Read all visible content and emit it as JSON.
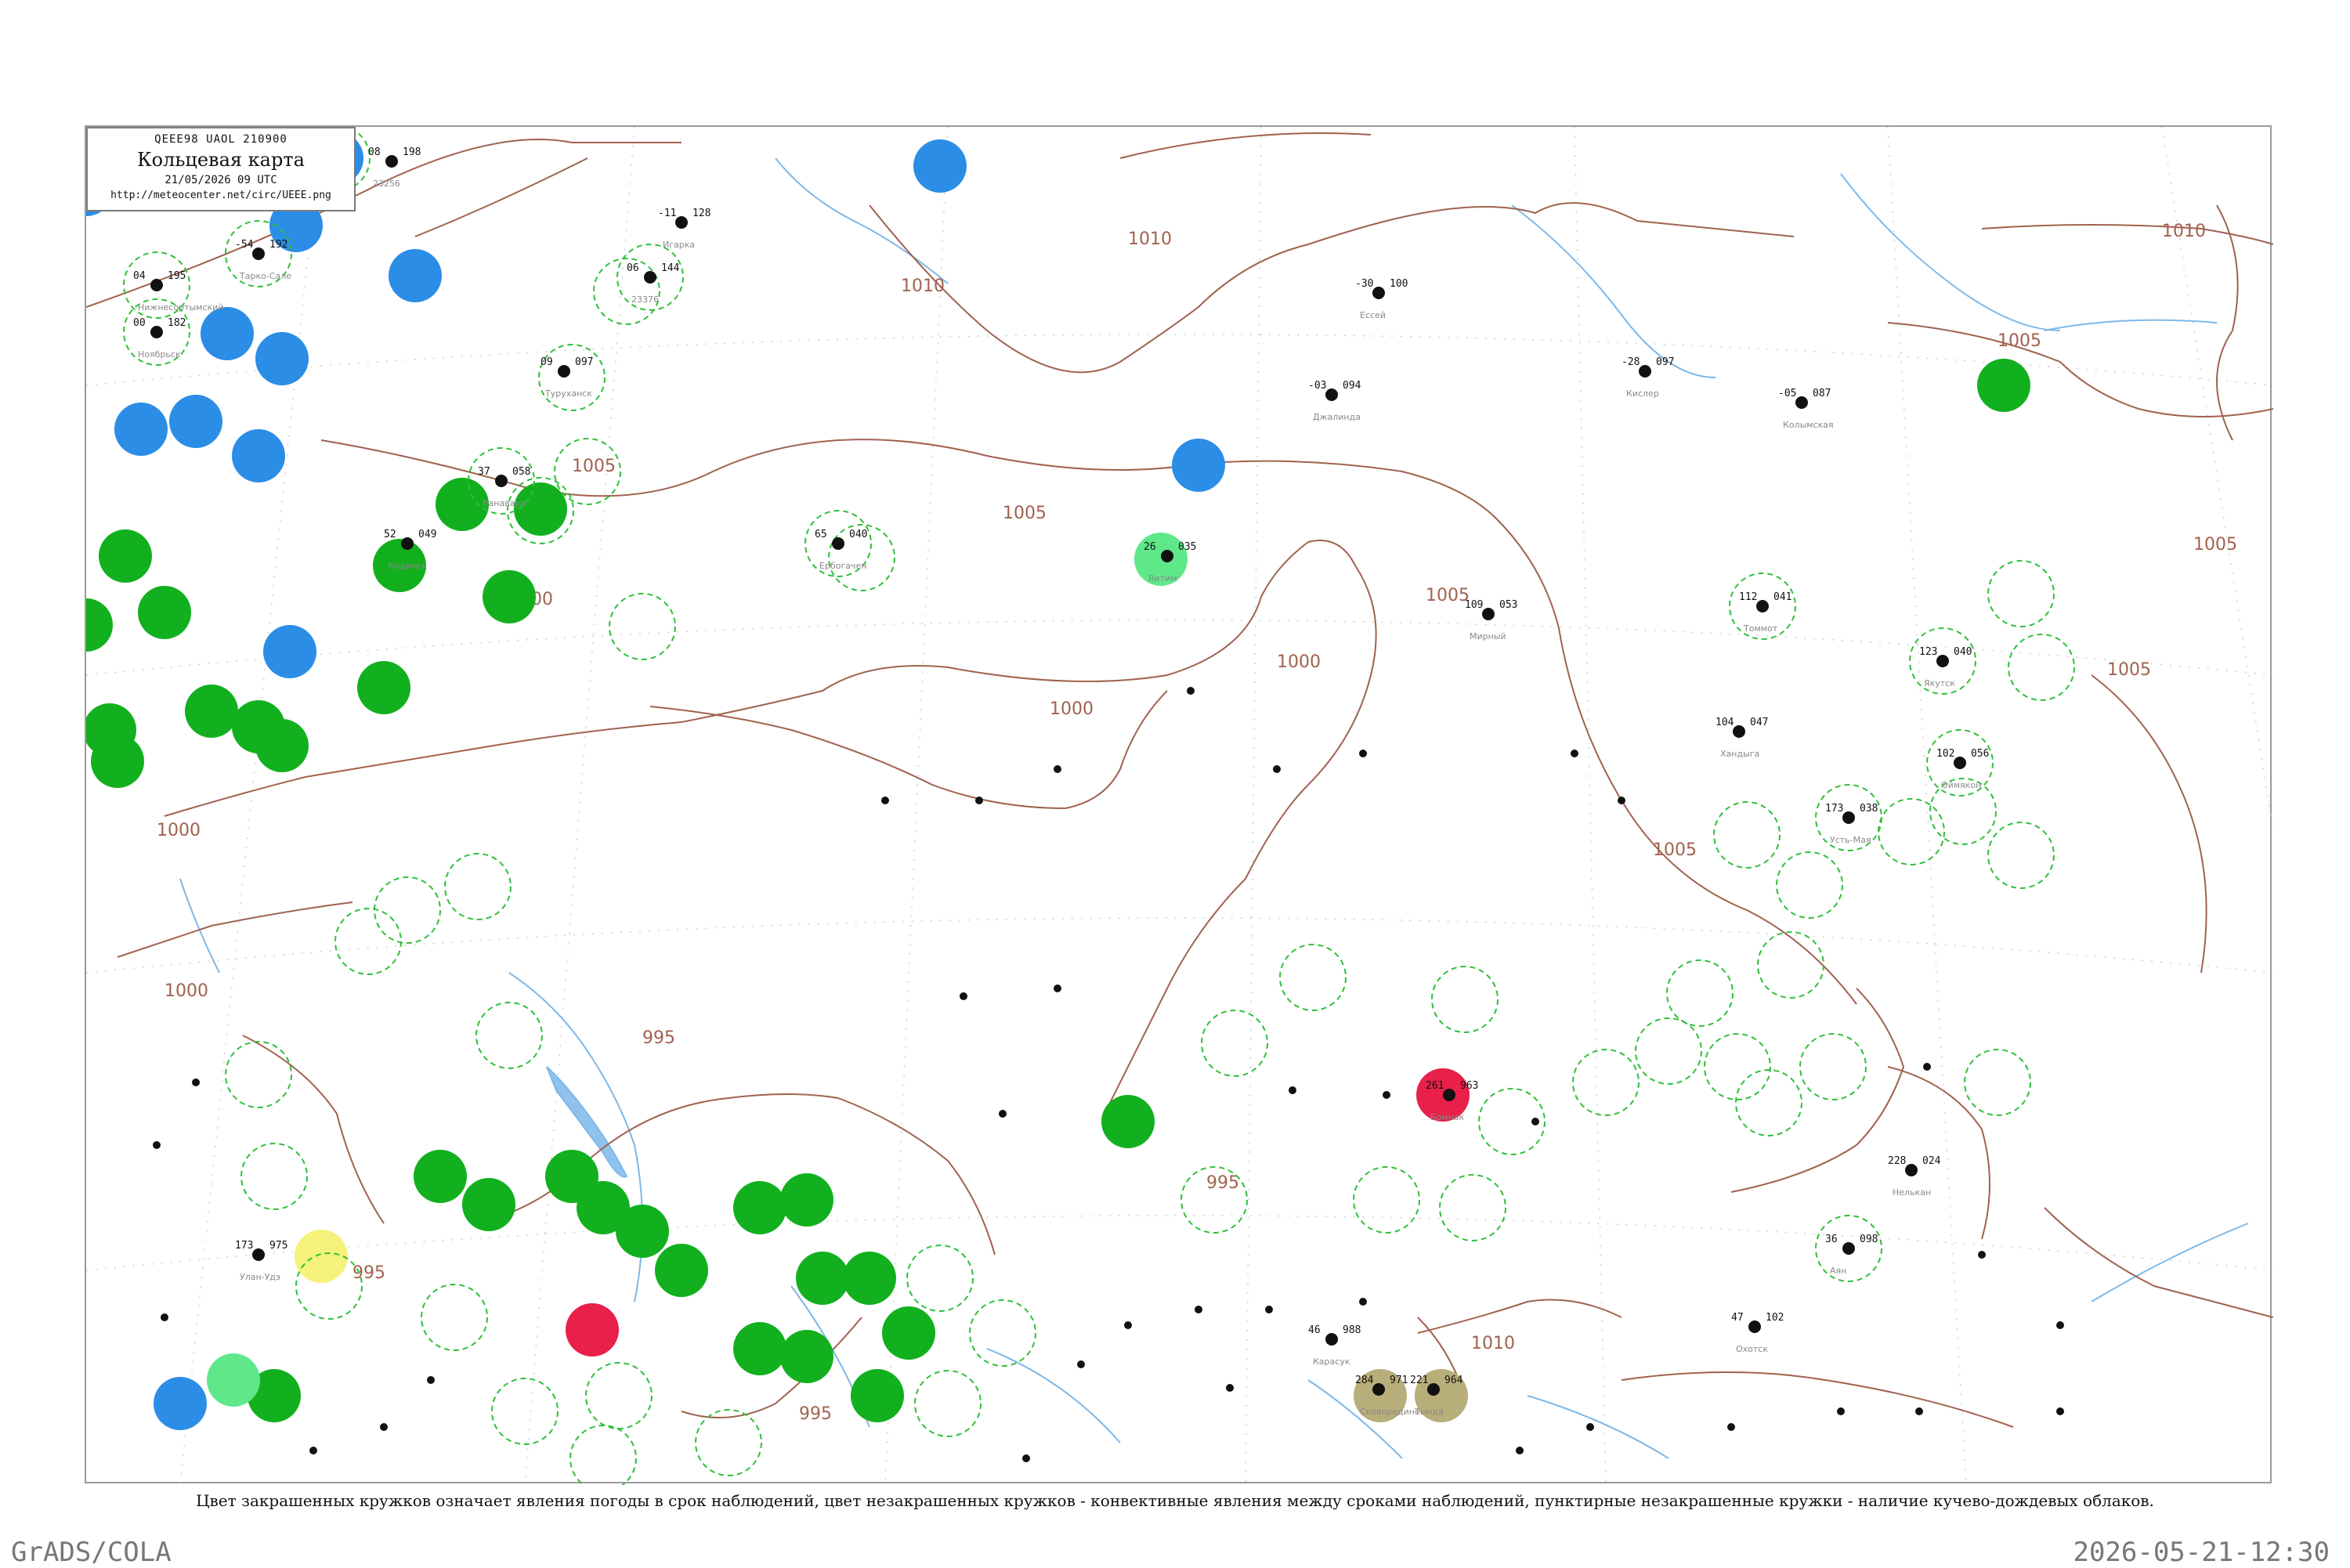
{
  "header": {
    "code": "QEEE98  UAOL  210900",
    "title": "Кольцевая карта",
    "date": "21/05/2026 09 UTC",
    "url": "http://meteocenter.net/circ/UEEE.png"
  },
  "caption": "Цвет закрашенных кружков означает явления погоды в срок наблюдений, цвет незакрашенных кружков - конвективные явления между сроками наблюдений, пунктирные незакрашенные кружки - наличие кучево-дождевых облаков.",
  "footer": {
    "left": "GrADS/COLA",
    "right": "2026-05-21-12:30"
  },
  "colors": {
    "isobar": "#a0624f",
    "river": "#7db8e8",
    "cb_ring": "#2fbf3a",
    "rain": "#12b01e",
    "snow": "#2b8de6",
    "thunder": "#e8204a",
    "fog": "#f4f27a",
    "dust": "#b8ae7a",
    "drizzle": "#5ee88a"
  },
  "isobars": [
    {
      "label": "1010"
    },
    {
      "label": "1010"
    },
    {
      "label": "1010"
    },
    {
      "label": "1005"
    },
    {
      "label": "1005"
    },
    {
      "label": "1005"
    },
    {
      "label": "1005"
    },
    {
      "label": "1000"
    },
    {
      "label": "1000"
    },
    {
      "label": "1000"
    },
    {
      "label": "1000"
    },
    {
      "label": "995"
    },
    {
      "label": "995"
    },
    {
      "label": "995"
    },
    {
      "label": "1010"
    },
    {
      "label": "1005"
    },
    {
      "label": "1005"
    },
    {
      "label": "1005"
    },
    {
      "label": "1000"
    },
    {
      "label": "995"
    }
  ],
  "stations": [
    {
      "p": "198",
      "t": "08",
      "name": "23256",
      "wx": "snow"
    },
    {
      "p": "195",
      "t": "04",
      "name": "Нижнесортымский",
      "wx": "cb"
    },
    {
      "p": "192",
      "t": "-54",
      "name": "Тарко-Сале",
      "wx": "cb"
    },
    {
      "p": "182",
      "t": "00",
      "name": "Ноябрьск",
      "wx": "cb"
    },
    {
      "p": "128",
      "t": "-11",
      "name": "Игарка",
      "wx": "none"
    },
    {
      "p": "144",
      "t": "06",
      "name": "23376",
      "wx": "cb"
    },
    {
      "p": "097",
      "t": "09",
      "name": "Туруханск",
      "wx": "none"
    },
    {
      "p": "100",
      "t": "-30",
      "name": "Ессей",
      "wx": "none"
    },
    {
      "p": "094",
      "t": "-03",
      "name": "Джалинда",
      "wx": "none"
    },
    {
      "p": "097",
      "t": "-28",
      "name": "Кислер",
      "wx": "none"
    },
    {
      "p": "087",
      "t": "-05",
      "name": "Колымская",
      "wx": "none"
    },
    {
      "p": "058",
      "t": "37",
      "name": "Ванавара",
      "wx": "cb"
    },
    {
      "p": "049",
      "t": "52",
      "name": "Кодинск",
      "wx": "none"
    },
    {
      "p": "040",
      "t": "65",
      "name": "Ербогачен",
      "wx": "cb"
    },
    {
      "p": "053",
      "t": "109",
      "name": "Мирный",
      "wx": "none"
    },
    {
      "p": "041",
      "t": "112",
      "name": "Томмот",
      "wx": "cb"
    },
    {
      "p": "040",
      "t": "123",
      "name": "Якутск",
      "wx": "cb"
    },
    {
      "p": "047",
      "t": "104",
      "name": "Хандыга",
      "wx": "none"
    },
    {
      "p": "056",
      "t": "102",
      "name": "Оймякон",
      "wx": "cb"
    },
    {
      "p": "038",
      "t": "173",
      "name": "Усть-Мая",
      "wx": "cb"
    },
    {
      "p": "024",
      "t": "228",
      "name": "Нелькан",
      "wx": "none"
    },
    {
      "p": "098",
      "t": "36",
      "name": "Аян",
      "wx": "cb"
    },
    {
      "p": "102",
      "t": "47",
      "name": "Охотск",
      "wx": "none"
    },
    {
      "p": "971",
      "t": "284",
      "name": "Сковородино",
      "wx": "dust"
    },
    {
      "p": "964",
      "t": "221",
      "name": "Тында",
      "wx": "dust"
    },
    {
      "p": "963",
      "t": "261",
      "name": "Бомнак",
      "wx": "thunder"
    },
    {
      "p": "988",
      "t": "46",
      "name": "Карасук",
      "wx": "fog"
    },
    {
      "p": "975",
      "t": "173",
      "name": "Улан-Удэ",
      "wx": "thunder"
    },
    {
      "p": "035",
      "t": "26",
      "name": "Витим",
      "wx": "drizzle"
    }
  ]
}
